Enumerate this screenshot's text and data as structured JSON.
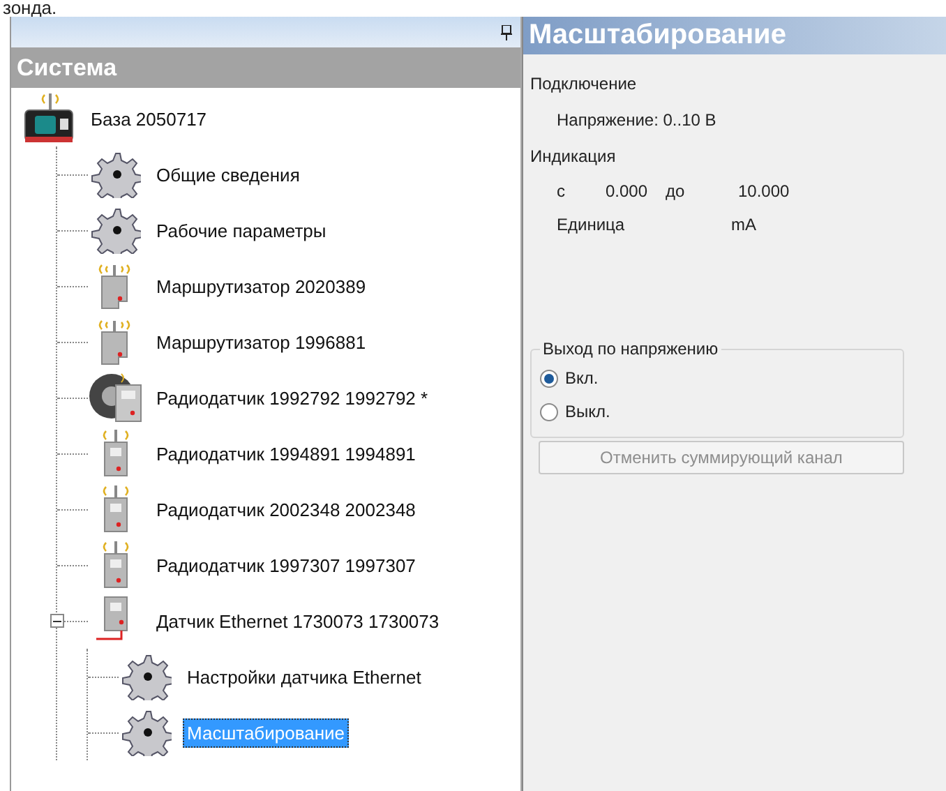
{
  "caption_above": "зонда.",
  "tree_panel": {
    "title": "Система",
    "nodes": [
      {
        "label": "База 2050717",
        "kind": "base",
        "selected": false,
        "children": [
          {
            "label": "Общие сведения",
            "kind": "gear",
            "selected": false
          },
          {
            "label": "Рабочие параметры",
            "kind": "gear",
            "selected": false
          },
          {
            "label": "Маршрутизатор 2020389",
            "kind": "router",
            "selected": false
          },
          {
            "label": "Маршрутизатор 1996881",
            "kind": "router",
            "selected": false
          },
          {
            "label": "Радиодатчик 1992792 1992792 *",
            "kind": "radio-active",
            "selected": false
          },
          {
            "label": "Радиодатчик 1994891 1994891",
            "kind": "radio",
            "selected": false
          },
          {
            "label": "Радиодатчик 2002348 2002348",
            "kind": "radio",
            "selected": false
          },
          {
            "label": "Радиодатчик 1997307 1997307",
            "kind": "radio",
            "selected": false
          },
          {
            "label": "Датчик Ethernet 1730073 1730073",
            "kind": "ethernet",
            "selected": false,
            "expanded": true,
            "children": [
              {
                "label": "Настройки датчика Ethernet",
                "kind": "gear",
                "selected": false
              },
              {
                "label": "Масштабирование",
                "kind": "gear",
                "selected": true
              }
            ]
          }
        ]
      }
    ]
  },
  "properties_panel": {
    "title": "Масштабирование",
    "connection": {
      "heading": "Подключение",
      "value": "Напряжение: 0..10 В"
    },
    "indication": {
      "heading": "Индикация",
      "from_label": "с",
      "from_value": "0.000",
      "to_label": "до",
      "to_value": "10.000",
      "unit_label": "Единица",
      "unit_value": "mA"
    },
    "voltage_output": {
      "title": "Выход по напряжению",
      "options": [
        {
          "label": "Вкл.",
          "selected": true
        },
        {
          "label": "Выкл.",
          "selected": false
        }
      ]
    },
    "cancel_button": {
      "label": "Отменить суммирующий канал",
      "disabled": true
    }
  }
}
